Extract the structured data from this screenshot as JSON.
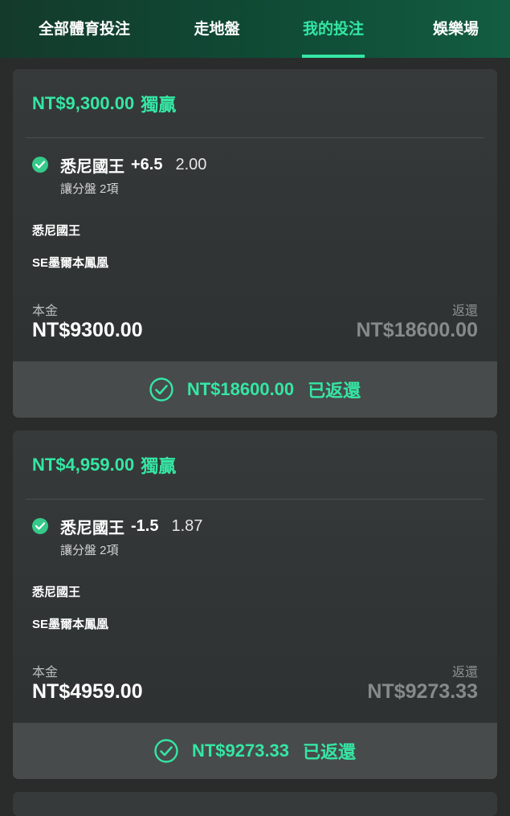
{
  "tabs": [
    {
      "label": "全部體育投注"
    },
    {
      "label": "走地盤"
    },
    {
      "label": "我的投注"
    },
    {
      "label": "娛樂場"
    }
  ],
  "active_tab": "我的投注",
  "colors": {
    "accent": "#35e6a4",
    "check_badge": "#35c98a",
    "header_bg": "#0f4a35",
    "page_bg": "#2a2c2c"
  },
  "bets": [
    {
      "header_amount": "NT$9,300.00",
      "header_type": "獨贏",
      "team": "悉尼國王",
      "line": "+6.5",
      "odds": "2.00",
      "market": "讓分盤 2項",
      "team_a": "悉尼國王",
      "team_b": "SE墨爾本鳳凰",
      "stake_label": "本金",
      "stake_value": "NT$9300.00",
      "return_label": "返還",
      "return_value": "NT$18600.00",
      "footer_amount": "NT$18600.00",
      "footer_status": "已返還"
    },
    {
      "header_amount": "NT$4,959.00",
      "header_type": "獨贏",
      "team": "悉尼國王",
      "line": "-1.5",
      "odds": "1.87",
      "market": "讓分盤 2項",
      "team_a": "悉尼國王",
      "team_b": "SE墨爾本鳳凰",
      "stake_label": "本金",
      "stake_value": "NT$4959.00",
      "return_label": "返還",
      "return_value": "NT$9273.33",
      "footer_amount": "NT$9273.33",
      "footer_status": "已返還"
    }
  ]
}
